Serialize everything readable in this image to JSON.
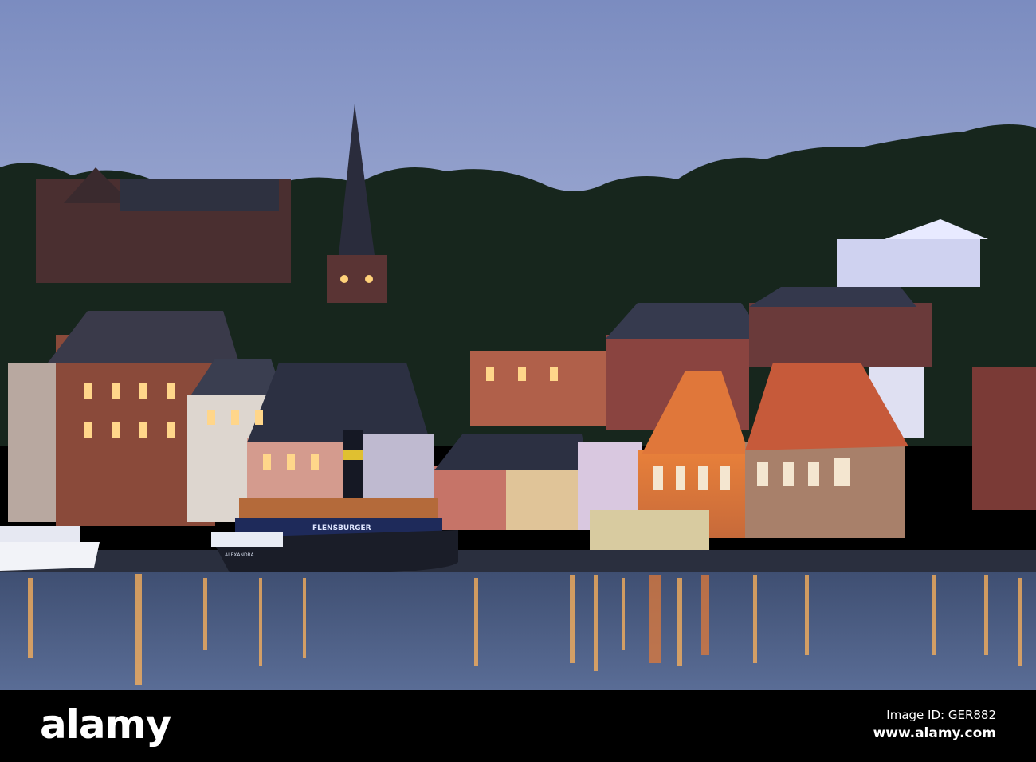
{
  "photo": {
    "subject": "Flensburg harbour at dusk",
    "ship_banner": "FLENSBURGER",
    "ship_name": "ALEXANDRA"
  },
  "watermark": {
    "logo": "alamy",
    "image_id": "Image ID: GER882",
    "url": "www.alamy.com"
  },
  "colors": {
    "sky_top": "#7d8fc0",
    "sky_bottom": "#a9b3d6",
    "trees": "#16241c",
    "water": "#4c5f86",
    "lights": "#ffb85a"
  }
}
